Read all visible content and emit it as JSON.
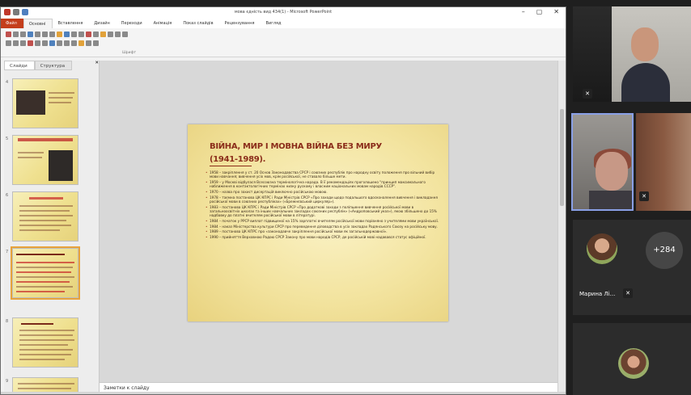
{
  "window": {
    "title": "мова єдність вид 434(1) - Microsoft PowerPoint",
    "controls": {
      "minimize": "–",
      "restore": "▢",
      "close": "✕"
    }
  },
  "ribbon": {
    "tabs": [
      "Файл",
      "Основні",
      "Вставлення",
      "Дизайн",
      "Переходи",
      "Анімація",
      "Показ слайдів",
      "Рецензування",
      "Вигляд"
    ],
    "group_label": "Шрифт"
  },
  "slides_pane": {
    "tabs": [
      "Слайди",
      "Структура"
    ],
    "close_glyph": "✕",
    "slide_numbers": [
      "4",
      "5",
      "6",
      "7",
      "8",
      "9"
    ]
  },
  "slide": {
    "title_line1": "ВІЙНА, МИР І МОВНА ВІЙНА БЕЗ МИРУ",
    "title_line2": "(1941-1989).",
    "bullets": [
      "1958 – закріплення у ст. 20 Основ Законодавства СРСР і союзних республік про народну освіту положення про вільний вибір мови навчання; вивчення усіх мов, крім російської, не ставало більше мети.",
      "1959 – у Москві відбулася Всесоюзна термінологічна нарада. В її рекомендаціях проголошено \"принцип максимального наближення в контактологічних термінах низку рускому і власним національних мовам народів СССР\".",
      "1970 – назва про захист дисертацій виключно російською мовою.",
      "1978 – таємна постанова ЦК КПРС і Ради Міністрів СРСР «Про заходи щодо подальшого вдосконалення вивчення і викладання російської мови в союзних республіках» («Брежнєвський циркуляр»).",
      "1983 – постанова ЦК КПРС і Ради Міністрів СРСР «Про додаткові заходи з поліпшення вивчення російської мови в загальноосвітніх школах та інших навчальних закладах союзних республік» («Андроповський указ»), якою збільшено до 15% надбавку до платні вчителям російської мови в літературі.",
      "1984 – початок у РРСР виплат підвищеної на 15% зарплатні вчителям російської мови порівняно з учителями мови української.",
      "1984 – наказ Міністерства культури СРСР про переведення діловодства в усіх закладах Радянського Союзу на російську мову.",
      "1989 – постанова ЦК КПРС про «законодавче закріплення російської мови як загальнодержавної».",
      "1990 – прийняття Верховною Радою СРСР Закону про мови народів СРСР, де російській мові надавався статус офіційної."
    ]
  },
  "notes": {
    "placeholder": "Заметки к слайду"
  },
  "video": {
    "participant_count": "+284",
    "participant_name": "Марина Лі...",
    "mute_icon": "✕"
  }
}
